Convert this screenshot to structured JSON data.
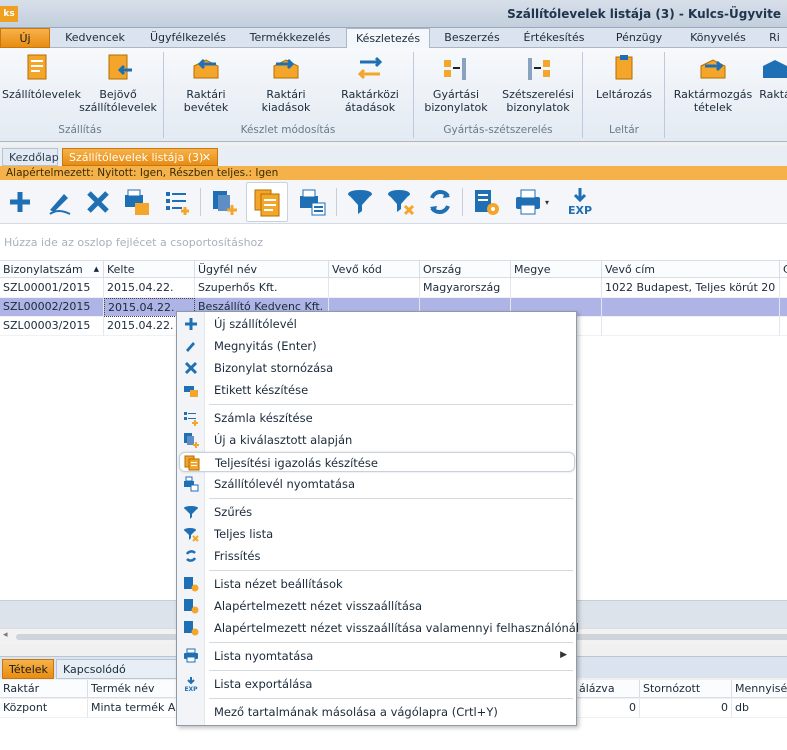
{
  "window": {
    "app_badge": "ks",
    "title": "Szállítólevelek listája (3) - Kulcs-Ügyvite"
  },
  "ribbon_tabs": [
    {
      "label": "Új"
    },
    {
      "label": "Kedvencek"
    },
    {
      "label": "Ügyfélkezelés"
    },
    {
      "label": "Termékkezelés"
    },
    {
      "label": "Készletezés"
    },
    {
      "label": "Beszerzés"
    },
    {
      "label": "Értékesítés"
    },
    {
      "label": "Pénzügy"
    },
    {
      "label": "Könyvelés"
    },
    {
      "label": "Ri"
    }
  ],
  "ribbon": {
    "buttons": {
      "szallitolevelek": "Szállítólevelek",
      "bejovo_1": "Bejövő",
      "bejovo_2": "szállítólevelek",
      "bevetek_1": "Raktári",
      "bevetek_2": "bevétek",
      "kiadasok_1": "Raktári",
      "kiadasok_2": "kiadások",
      "atadasok_1": "Raktárközi",
      "atadasok_2": "átadások",
      "gyartasi_1": "Gyártási",
      "gyartasi_2": "bizonylatok",
      "szetszereles_1": "Szétszerelési",
      "szetszereles_2": "bizonylatok",
      "leltarozas": "Leltározás",
      "raktarmozgas_1": "Raktármozgás",
      "raktarmozgas_2": "tételek",
      "rakt": "Raktá"
    },
    "groups": {
      "szallitas": "Szállítás",
      "keszlet": "Készlet módosítás",
      "gyartas": "Gyártás-szétszerelés",
      "leltar": "Leltár"
    }
  },
  "doc_tabs": {
    "home": "Kezdőlap",
    "current": "Szállítólevelek listája (3)",
    "close": "✕"
  },
  "filter_text": "Alapértelmezett: Nyitott: Igen, Részben teljes.: Igen",
  "group_hint": "Húzza ide az oszlop fejlécet a csoportosításhoz",
  "grid": {
    "columns": [
      "Bizonylatszám",
      "Kelte",
      "Ügyfél név",
      "Vevő kód",
      "Ország",
      "Megye",
      "Vevő cím",
      "C"
    ],
    "sort_indicator": "▲",
    "rows": [
      [
        "SZL00001/2015",
        "2015.04.22.",
        "Szuperhős Kft.",
        "",
        "Magyarország",
        "",
        "1022 Budapest, Teljes körút 20",
        ""
      ],
      [
        "SZL00002/2015",
        "2015.04.22.",
        "Beszállító Kedvenc Kft.",
        "",
        "",
        "",
        "",
        ""
      ],
      [
        "SZL00003/2015",
        "2015.04.22.",
        "",
        "",
        "",
        "",
        "",
        ""
      ]
    ]
  },
  "context_menu": {
    "items": [
      {
        "label": "Új szállítólevél",
        "icon": "plus-icon"
      },
      {
        "label": "Megnyitás (Enter)",
        "icon": "pencil-icon"
      },
      {
        "label": "Bizonylat stornózása",
        "icon": "x-icon"
      },
      {
        "label": "Etikett készítése",
        "icon": "label-printer-icon"
      },
      {
        "label": "Számla készítése",
        "icon": "invoice-list-icon"
      },
      {
        "label": "Új a kiválasztott alapján",
        "icon": "copy-new-icon"
      },
      {
        "label": "Teljesítési igazolás készítése",
        "icon": "certificate-icon"
      },
      {
        "label": "Szállítólevél nyomtatása",
        "icon": "print-list-icon"
      },
      {
        "label": "Szűrés",
        "icon": "filter-icon"
      },
      {
        "label": "Teljes lista",
        "icon": "clear-filter-icon"
      },
      {
        "label": "Frissítés",
        "icon": "refresh-icon"
      },
      {
        "label": "Lista nézet beállítások",
        "icon": "list-settings-icon"
      },
      {
        "label": "Alapértelmezett nézet visszaállítása",
        "icon": "reset-view-icon"
      },
      {
        "label": "Alapértelmezett nézet visszaállítása valamennyi felhasználónál",
        "icon": "reset-all-icon"
      },
      {
        "label": "Lista nyomtatása",
        "icon": "printer-icon"
      },
      {
        "label": "Lista exportálása",
        "icon": "export-icon"
      },
      {
        "label": "Mező tartalmának másolása a vágólapra (Crtl+Y)",
        "icon": ""
      }
    ],
    "submenu_arrow": "▶"
  },
  "bottom": {
    "tabs": [
      "Tételek",
      "Kapcsolódó bizonylatok"
    ],
    "columns": [
      "Raktár",
      "Termék név",
      "álázva",
      "Stornózott",
      "Mennyiség"
    ],
    "row": [
      "Központ",
      "Minta termék A",
      "0",
      "0",
      "db"
    ]
  },
  "colors": {
    "accent": "#f0a020",
    "selection": "#aeb4e6",
    "icon_blue": "#1f6fb5"
  }
}
